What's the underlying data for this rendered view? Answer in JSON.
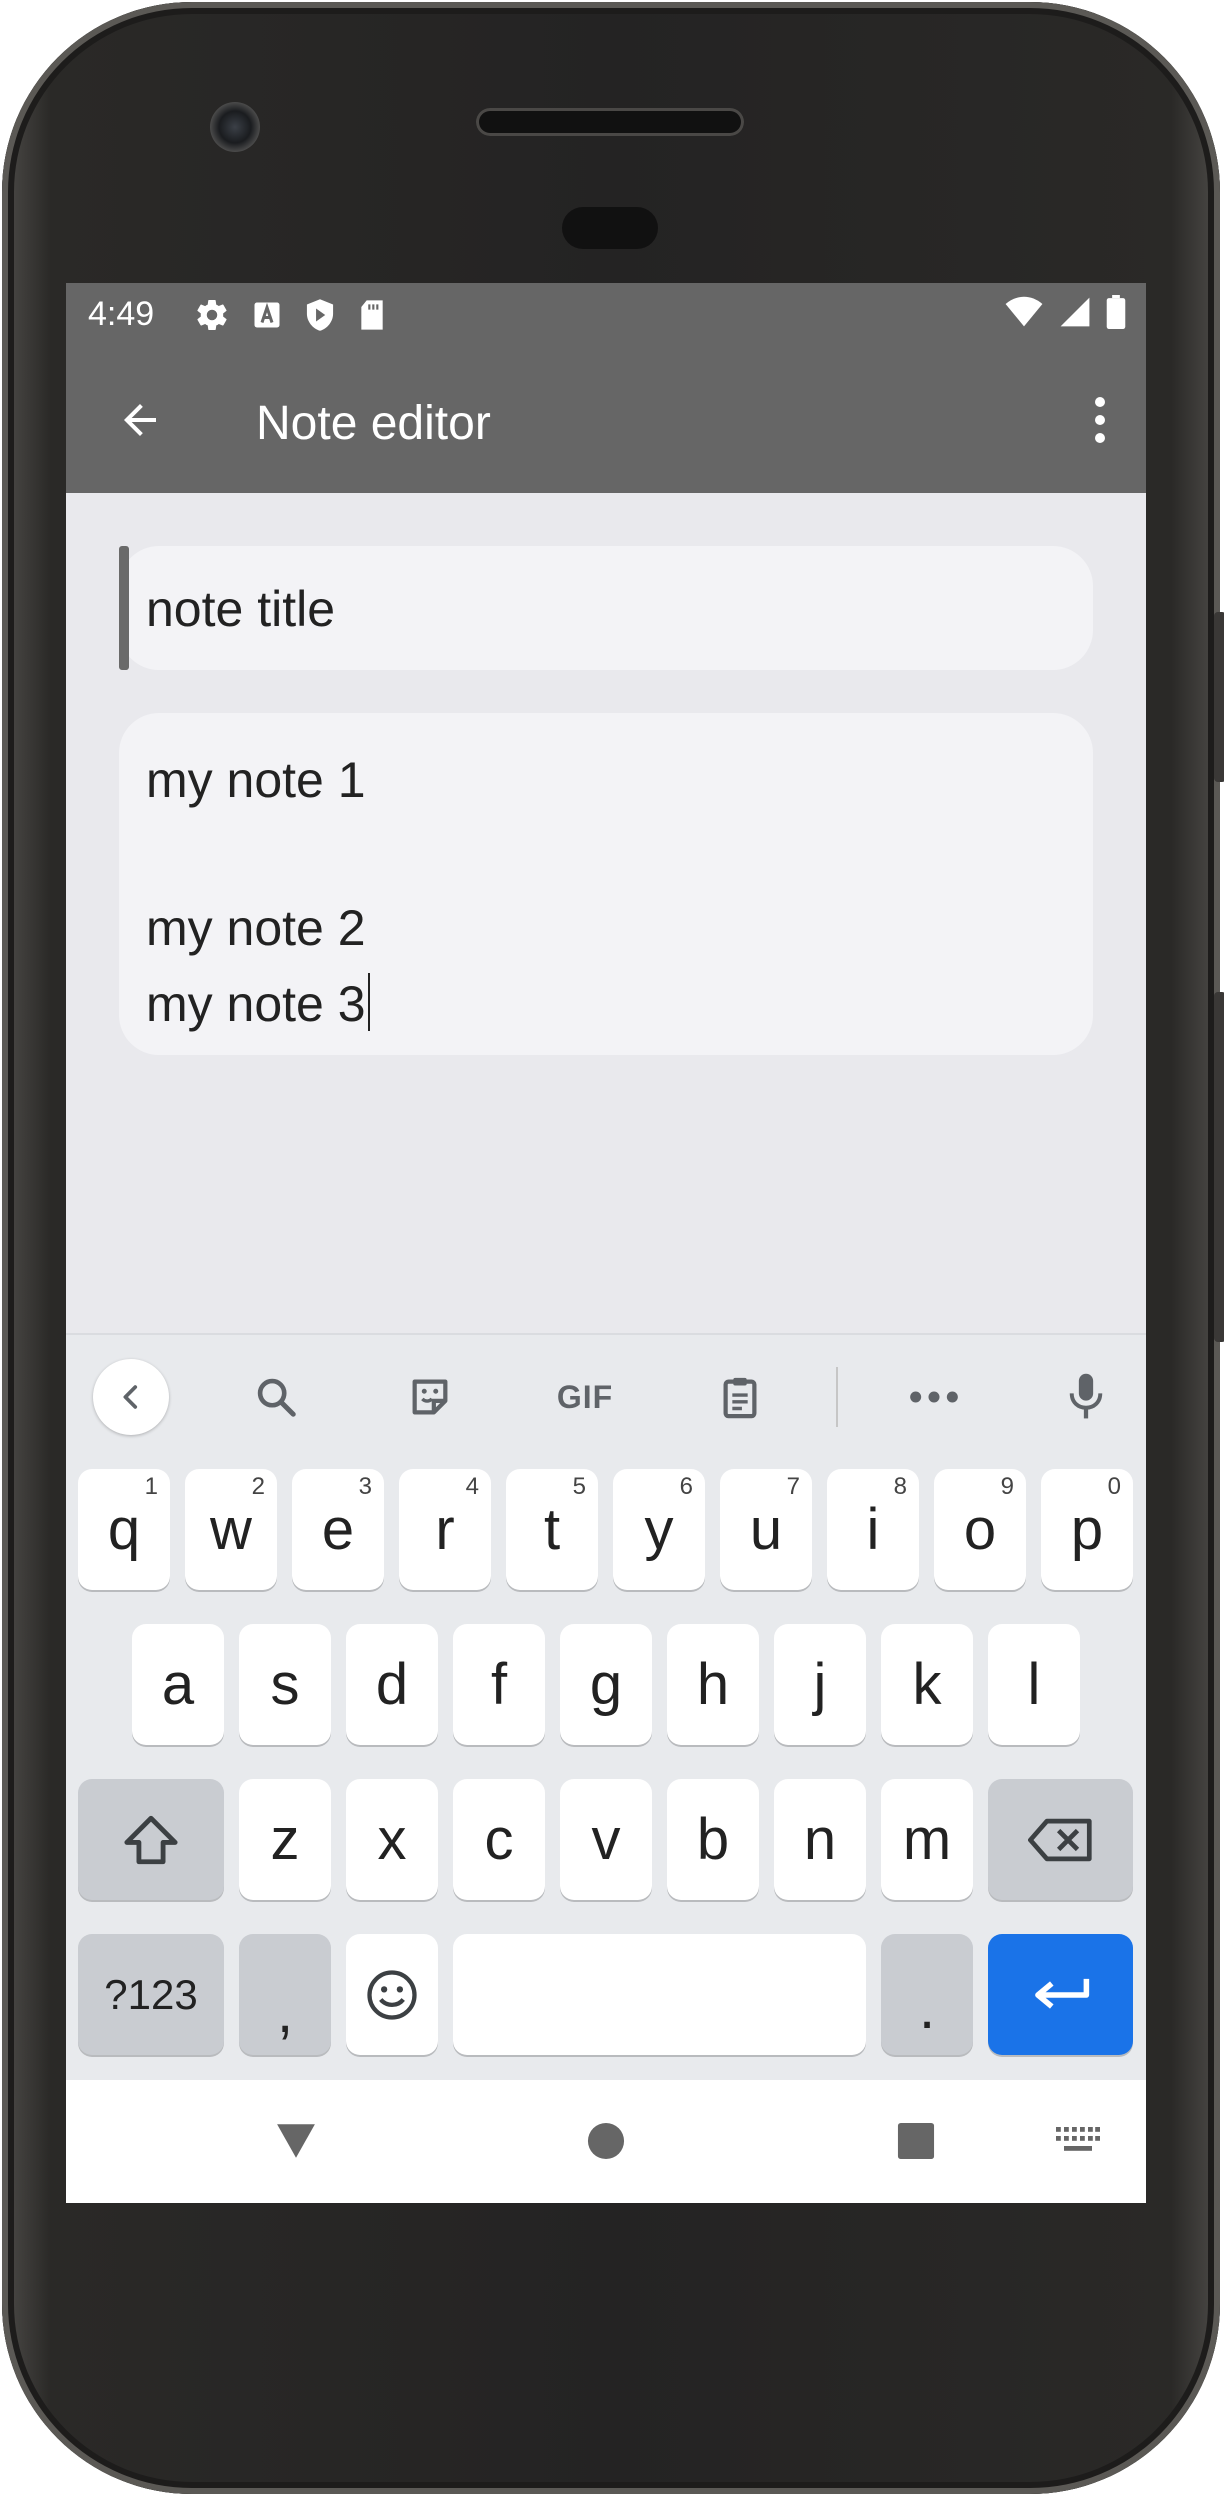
{
  "status_bar": {
    "time": "4:49",
    "icons_left": [
      "settings-icon",
      "text-a-icon",
      "shield-icon",
      "sd-card-icon"
    ],
    "icons_right": [
      "wifi-icon",
      "signal-icon",
      "battery-icon"
    ]
  },
  "app_bar": {
    "title": "Note editor",
    "back_icon": "arrow-back-icon",
    "menu_icon": "more-vert-icon"
  },
  "note": {
    "title_value": "note title",
    "body_lines": [
      "my note 1",
      "",
      "my note 2",
      "my note 3"
    ]
  },
  "keyboard": {
    "toolbar": {
      "items": [
        "chevron-left-icon",
        "search-icon",
        "sticker-icon",
        "GIF",
        "clipboard-icon",
        "more-horiz-icon",
        "mic-icon"
      ],
      "gif_label": "GIF"
    },
    "row1": [
      {
        "key": "q",
        "hint": "1"
      },
      {
        "key": "w",
        "hint": "2"
      },
      {
        "key": "e",
        "hint": "3"
      },
      {
        "key": "r",
        "hint": "4"
      },
      {
        "key": "t",
        "hint": "5"
      },
      {
        "key": "y",
        "hint": "6"
      },
      {
        "key": "u",
        "hint": "7"
      },
      {
        "key": "i",
        "hint": "8"
      },
      {
        "key": "o",
        "hint": "9"
      },
      {
        "key": "p",
        "hint": "0"
      }
    ],
    "row2": [
      "a",
      "s",
      "d",
      "f",
      "g",
      "h",
      "j",
      "k",
      "l"
    ],
    "row3": [
      "z",
      "x",
      "c",
      "v",
      "b",
      "n",
      "m"
    ],
    "row4": {
      "symbols_label": "?123",
      "comma_label": ",",
      "period_label": ".",
      "emoji_icon": "emoji-icon",
      "enter_icon": "enter-icon"
    },
    "accent_color": "#1a73e8"
  },
  "nav_bar": {
    "items": [
      "back-triangle-icon",
      "home-circle-icon",
      "recents-square-icon",
      "keyboard-switch-icon"
    ]
  }
}
